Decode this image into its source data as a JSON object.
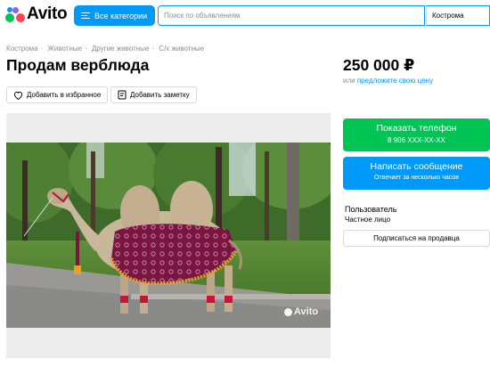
{
  "header": {
    "logo_text": "Avito",
    "categories_label": "Все категории",
    "search_placeholder": "Поиск по объявлениям",
    "city": "Кострома"
  },
  "breadcrumbs": [
    "Кострома",
    "Животные",
    "Другие животные",
    "С/х животные"
  ],
  "listing": {
    "title": "Продам верблюда",
    "price": "250 000 ₽",
    "price_alt_prefix": "или",
    "price_alt_link": "предложите свою цену",
    "favorite_label": "Добавить в избранное",
    "note_label": "Добавить заметку",
    "watermark": "Avito"
  },
  "contact": {
    "phone_label": "Показать телефон",
    "phone_masked": "8 906 XXX-XX-XX",
    "message_label": "Написать сообщение",
    "message_sub": "Отвечает за несколько часов"
  },
  "seller": {
    "name": "Пользователь",
    "type": "Частное лицо",
    "subscribe_label": "Подписаться на продавца"
  },
  "colors": {
    "brand_blue": "#0099f7",
    "phone_green": "#00c453",
    "muted_text": "#8c8c8c"
  },
  "icons": [
    "logo-dots-icon",
    "burger-icon",
    "heart-icon",
    "note-icon"
  ]
}
